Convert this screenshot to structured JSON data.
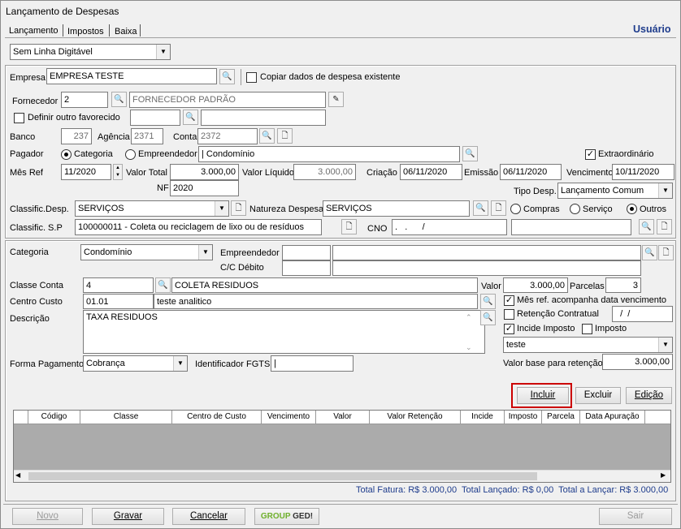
{
  "window": {
    "title": "Lançamento de Despesas",
    "user": "Usuário"
  },
  "tabs": [
    "Lançamento",
    "Impostos",
    "Baixa"
  ],
  "linha_digitavel": "Sem Linha Digitável",
  "empresa": {
    "label": "Empresa",
    "value": "EMPRESA TESTE",
    "copy_label": "Copiar dados de despesa existente"
  },
  "fornecedor": {
    "label": "Fornecedor",
    "code": "2",
    "name": "FORNECEDOR PADRÃO"
  },
  "favorecido": {
    "label": "Definir outro favorecido"
  },
  "banco": {
    "label": "Banco",
    "value": "237",
    "agencia_label": "Agência",
    "agencia": "2371",
    "conta_label": "Conta",
    "conta": "2372"
  },
  "pagador": {
    "label": "Pagador",
    "opt1": "Categoria",
    "opt2": "Empreendedor",
    "value": "| Condomínio",
    "extra_label": "Extraordinário"
  },
  "datas": {
    "mesref_label": "Mês Ref",
    "mesref": "11/2020",
    "vtotal_label": "Valor Total",
    "vtotal": "3.000,00",
    "vliq_label": "Valor Líquido",
    "vliq": "3.000,00",
    "criacao_label": "Criação",
    "criacao": "06/11/2020",
    "emissao_label": "Emissão",
    "emissao": "06/11/2020",
    "venc_label": "Vencimento",
    "venc": "10/11/2020"
  },
  "nf": {
    "label": "NF",
    "value": "2020"
  },
  "tipodesp": {
    "label": "Tipo Desp.",
    "value": "Lançamento Comum"
  },
  "classif": {
    "label": "Classific.Desp.",
    "value": "SERVIÇOS",
    "natureza_label": "Natureza Despesa",
    "natureza": "SERVIÇOS",
    "r1": "Compras",
    "r2": "Serviço",
    "r3": "Outros"
  },
  "classifsp": {
    "label": "Classific. S.P",
    "value": "100000011 - Coleta ou reciclagem de lixo ou de resíduos",
    "cno_label": "CNO",
    "cno": ".   .      /"
  },
  "item": {
    "cat_label": "Categoria",
    "cat": "Condomínio",
    "emp_label": "Empreendedor",
    "cc_label": "C/C Débito",
    "classe_label": "Classe Conta",
    "classe_code": "4",
    "classe_name": "COLETA RESIDUOS",
    "valor_label": "Valor",
    "valor": "3.000,00",
    "parcelas_label": "Parcelas",
    "parcelas": "3",
    "centro_label": "Centro Custo",
    "centro_code": "01.01",
    "centro_name": "teste analitico",
    "mesref_venc": "Mês ref. acompanha data vencimento",
    "desc_label": "Descrição",
    "desc": "TAXA RESIDUOS",
    "retencao": "Retenção Contratual",
    "retencao_date": "  /  /",
    "incide": "Incide Imposto",
    "imposto": "Imposto",
    "imposto_sel": "teste",
    "forma_label": "Forma Pagamento",
    "forma": "Cobrança",
    "fgts_label": "Identificador FGTS",
    "vbase_label": "Valor base para retenção",
    "vbase": "3.000,00"
  },
  "actions": {
    "incluir": "Incluir",
    "excluir": "Excluir",
    "edicao": "Edição"
  },
  "grid_headers": [
    "Código",
    "Classe",
    "Centro de Custo",
    "Vencimento",
    "Valor",
    "Valor Retenção",
    "Incide",
    "Imposto",
    "Parcela",
    "Data Apuração"
  ],
  "totals": "Total Fatura: R$ 3.000,00  Total Lançado: R$ 0,00  Total a Lançar: R$ 3.000,00",
  "footer": {
    "novo": "Novo",
    "gravar": "Gravar",
    "cancelar": "Cancelar",
    "ged1": "GROUP",
    "ged2": "GED!",
    "sair": "Sair"
  },
  "colors": {
    "accent": "#1e3c8c",
    "highlight": "#cc0000"
  }
}
